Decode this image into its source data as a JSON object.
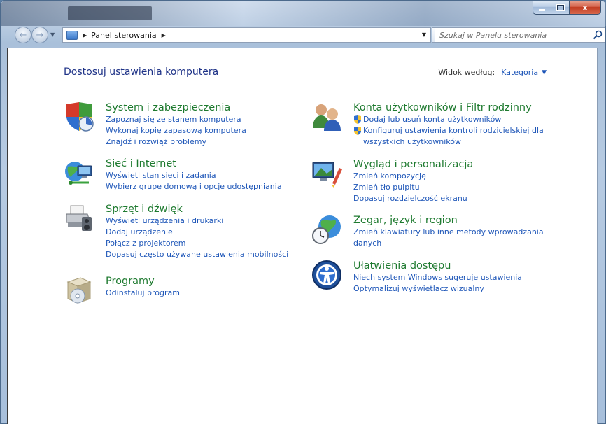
{
  "window": {
    "close_glyph": "x"
  },
  "nav": {
    "back_glyph": "←",
    "forward_glyph": "→",
    "breadcrumb": "Panel sterowania",
    "search_placeholder": "Szukaj w Panelu sterowania"
  },
  "header": {
    "title": "Dostosuj ustawienia komputera",
    "view_by_label": "Widok według:",
    "view_by_value": "Kategoria"
  },
  "categories": {
    "system": {
      "title": "System i zabezpieczenia",
      "links": [
        "Zapoznaj się ze stanem komputera",
        "Wykonaj kopię zapasową komputera",
        "Znajdź i rozwiąż problemy"
      ]
    },
    "network": {
      "title": "Sieć i Internet",
      "links": [
        "Wyświetl stan sieci i zadania",
        "Wybierz grupę domową i opcje udostępniania"
      ]
    },
    "hardware": {
      "title": "Sprzęt i dźwięk",
      "links": [
        "Wyświetl urządzenia i drukarki",
        "Dodaj urządzenie",
        "Połącz z projektorem",
        "Dopasuj często używane ustawienia mobilności"
      ]
    },
    "programs": {
      "title": "Programy",
      "links": [
        "Odinstaluj program"
      ]
    },
    "accounts": {
      "title": "Konta użytkowników i Filtr rodzinny",
      "links": [
        "Dodaj lub usuń konta użytkowników",
        "Konfiguruj ustawienia kontroli rodzicielskiej dla",
        "wszystkich użytkowników"
      ]
    },
    "appearance": {
      "title": "Wygląd i personalizacja",
      "links": [
        "Zmień kompozycję",
        "Zmień tło pulpitu",
        "Dopasuj rozdzielczość ekranu"
      ]
    },
    "clock": {
      "title": "Zegar, język i region",
      "links": [
        "Zmień klawiatury lub inne metody wprowadzania",
        "danych"
      ]
    },
    "ease": {
      "title": "Ułatwienia dostępu",
      "links": [
        "Niech system Windows sugeruje ustawienia",
        "Optymalizuj wyświetlacz wizualny"
      ]
    }
  }
}
